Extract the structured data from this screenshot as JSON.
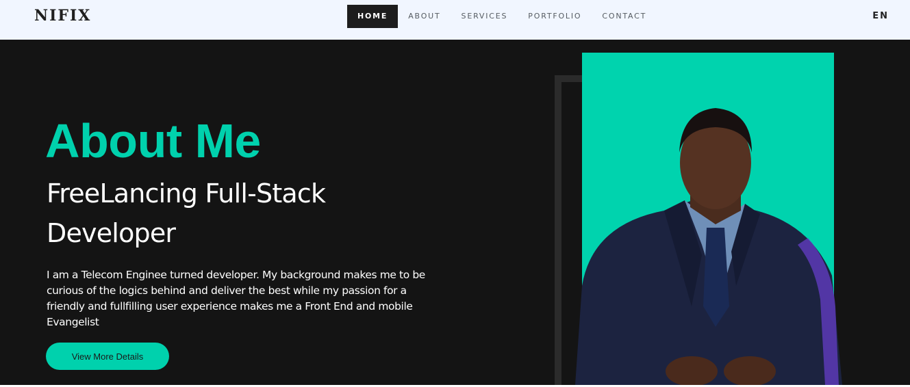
{
  "brand": {
    "name": "NIFIX"
  },
  "nav": {
    "items": [
      {
        "label": "HOME",
        "active": true
      },
      {
        "label": "ABOUT",
        "active": false
      },
      {
        "label": "SERVICES",
        "active": false
      },
      {
        "label": "PORTFOLIO",
        "active": false
      },
      {
        "label": "CONTACT",
        "active": false
      }
    ],
    "language": "EN"
  },
  "hero": {
    "title": "About Me",
    "subtitle_line1": "FreeLancing Full-Stack",
    "subtitle_line2": "Developer",
    "description_line1": "I am a Telecom Enginee turned developer. My background makes me to be",
    "description_line2": "curious of the logics behind and deliver the best while my passion for a",
    "description_line3": "friendly and fullfilling user experience makes me a Front End and mobile",
    "description_line4": "Evangelist",
    "cta_label": "View More Details"
  },
  "colors": {
    "accent": "#00d1ad",
    "hero_background": "#141414",
    "nav_background": "#f1f6ff",
    "nav_active": "#1d1d1d"
  }
}
